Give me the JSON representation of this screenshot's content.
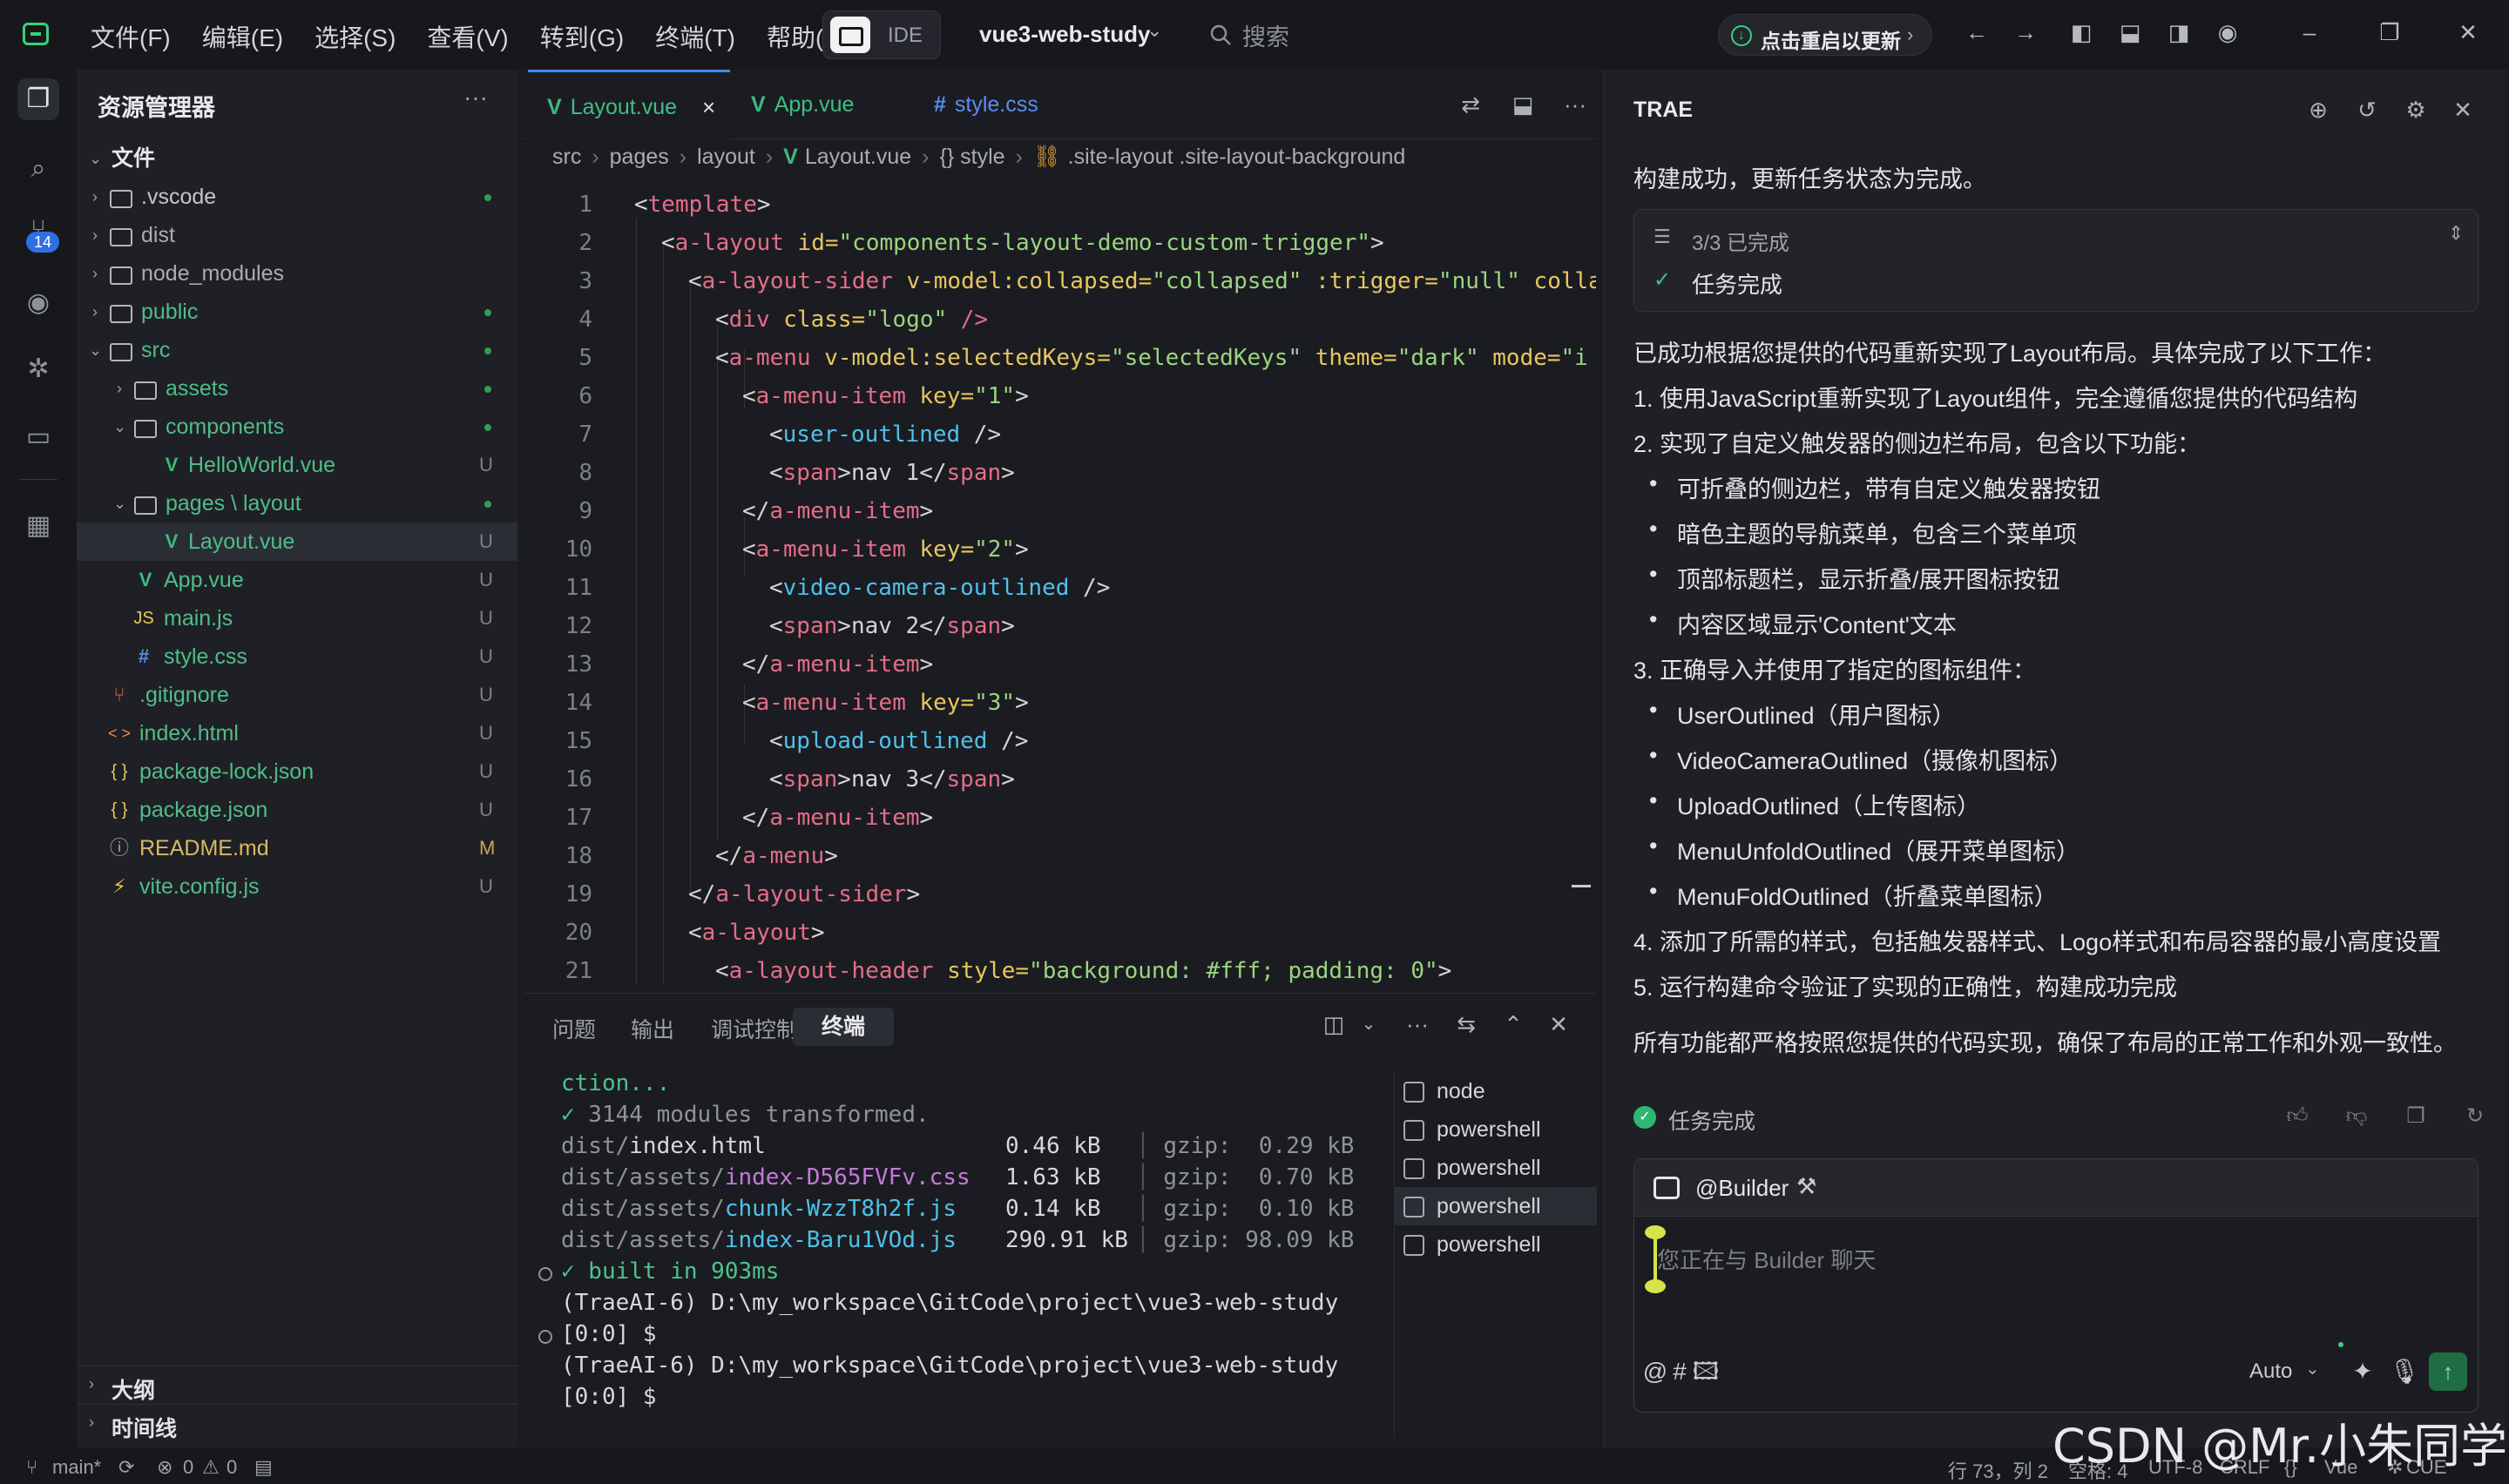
{
  "titlebar": {
    "menus": [
      "文件(F)",
      "编辑(E)",
      "选择(S)",
      "查看(V)",
      "转到(G)",
      "终端(T)",
      "帮助(H)"
    ],
    "mode_label": "IDE",
    "project": "vue3-web-study",
    "search_placeholder": "搜索",
    "update_label": "点击重启以更新"
  },
  "activity": {
    "badge": "14"
  },
  "explorer": {
    "title": "资源管理器",
    "root": "文件",
    "items": [
      {
        "name": ".vscode",
        "status": "",
        "dot": true
      },
      {
        "name": "dist",
        "status": "",
        "dot": false
      },
      {
        "name": "node_modules",
        "status": "",
        "dot": false
      },
      {
        "name": "public",
        "status": "",
        "dot": true
      },
      {
        "name": "src",
        "status": "",
        "dot": true
      },
      {
        "name": "assets",
        "status": "",
        "dot": true
      },
      {
        "name": "components",
        "status": "",
        "dot": true
      },
      {
        "name": "HelloWorld.vue",
        "status": "U"
      },
      {
        "name": "pages \\ layout",
        "status": "",
        "dot": true
      },
      {
        "name": "Layout.vue",
        "status": "U"
      },
      {
        "name": "App.vue",
        "status": "U"
      },
      {
        "name": "main.js",
        "status": "U"
      },
      {
        "name": "style.css",
        "status": "U"
      },
      {
        "name": ".gitignore",
        "status": "U"
      },
      {
        "name": "index.html",
        "status": "U"
      },
      {
        "name": "package-lock.json",
        "status": "U"
      },
      {
        "name": "package.json",
        "status": "U"
      },
      {
        "name": "README.md",
        "status": "M"
      },
      {
        "name": "vite.config.js",
        "status": "U"
      }
    ],
    "icons": {
      "js": "JS",
      "css": "#",
      "json": "{ }",
      "html": "< >",
      "info": "ⓘ",
      "git": "⑂",
      "vite": "⚡"
    },
    "outline_label": "大纲",
    "timeline_label": "时间线"
  },
  "editor": {
    "tabs": [
      "Layout.vue",
      "App.vue",
      "style.css"
    ],
    "breadcrumb": [
      "src",
      "pages",
      "layout",
      "Layout.vue",
      "{} style",
      ".site-layout .site-layout-background"
    ],
    "line_numbers": [
      "1",
      "2",
      "3",
      "4",
      "5",
      "6",
      "7",
      "8",
      "9",
      "10",
      "11",
      "12",
      "13",
      "14",
      "15",
      "16",
      "17",
      "18",
      "19",
      "20",
      "21"
    ],
    "code": {
      "l1_tag": "template",
      "l2_tag": "a-layout",
      "l2_attr": " id=",
      "l2_val": "\"components-layout-demo-custom-trigger\"",
      "l3_tag": "a-layout-sider",
      "l3_attr1": " v-model:collapsed=",
      "l3_val1": "\"collapsed\"",
      "l3_attr2": " :trigger=",
      "l3_val2": "\"null\"",
      "l3_rest": " colla",
      "l4_tag": "div",
      "l4_attr": " class=",
      "l4_val": "\"logo\"",
      "l4_end": " />",
      "l5_tag": "a-menu",
      "l5_attr1": " v-model:selectedKeys=",
      "l5_val1": "\"selectedKeys\"",
      "l5_attr2": " theme=",
      "l5_val2": "\"dark\"",
      "l5_attr3": " mode=",
      "l5_val3": "\"i",
      "item_tag": "a-menu-item",
      "key_attr": " key=",
      "key1": "\"1\"",
      "key2": "\"2\"",
      "key3": "\"3\"",
      "icon1": "user-outlined",
      "icon2": "video-camera-outlined",
      "icon3": "upload-outlined",
      "span_tag": "span",
      "nav1": "nav 1",
      "nav2": "nav 2",
      "nav3": "nav 3",
      "l18_tag": "a-menu",
      "l19_tag": "a-layout-sider",
      "l20_tag": "a-layout",
      "l21_tag": "a-layout-header",
      "l21_attr": " style=",
      "l21_val": "\"background: #fff; padding: 0\""
    }
  },
  "panel": {
    "tabs": [
      "问题",
      "输出",
      "调试控制台",
      "终端"
    ],
    "terminal": {
      "l1": "ction...",
      "l2_check": "✓",
      "l2": " 3144 modules transformed.",
      "files": [
        {
          "dir": "dist/",
          "file": "index.html",
          "size": "0.46 kB",
          "gzip": "gzip:  0.29 kB"
        },
        {
          "dir": "dist/assets/",
          "file": "index-D565FVFv.css",
          "size": "1.63 kB",
          "gzip": "gzip:  0.70 kB"
        },
        {
          "dir": "dist/assets/",
          "file": "chunk-WzzT8h2f.js",
          "size": "0.14 kB",
          "gzip": "gzip:  0.10 kB"
        },
        {
          "dir": "dist/assets/",
          "file": "index-Baru1VOd.js",
          "size": "290.91 kB",
          "gzip": "gzip: 98.09 kB"
        }
      ],
      "built": "✓ built in 903ms",
      "prompt1": "(TraeAI-6) D:\\my_workspace\\GitCode\\project\\vue3-web-study",
      "prompt1b": "[0:0] $",
      "prompt2": "(TraeAI-6) D:\\my_workspace\\GitCode\\project\\vue3-web-study",
      "prompt2b": "[0:0] $"
    },
    "terminal_list": [
      "node",
      "powershell",
      "powershell",
      "powershell",
      "powershell"
    ]
  },
  "chat": {
    "title": "TRAE",
    "intro": "构建成功，更新任务状态为完成。",
    "task_count": "3/3 已完成",
    "task_done": "任务完成",
    "summary": "已成功根据您提供的代码重新实现了Layout布局。具体完成了以下工作：",
    "p1": "1. 使用JavaScript重新实现了Layout组件，完全遵循您提供的代码结构",
    "p2": "2. 实现了自定义触发器的侧边栏布局，包含以下功能：",
    "p2_items": [
      "可折叠的侧边栏，带有自定义触发器按钮",
      "暗色主题的导航菜单，包含三个菜单项",
      "顶部标题栏，显示折叠/展开图标按钮",
      "内容区域显示'Content'文本"
    ],
    "p3": "3. 正确导入并使用了指定的图标组件：",
    "p3_items": [
      "UserOutlined（用户图标）",
      "VideoCameraOutlined（摄像机图标）",
      "UploadOutlined（上传图标）",
      "MenuUnfoldOutlined（展开菜单图标）",
      "MenuFoldOutlined（折叠菜单图标）"
    ],
    "p4": "4. 添加了所需的样式，包括触发器样式、Logo样式和布局容器的最小高度设置",
    "p5": "5. 运行构建命令验证了实现的正确性，构建成功完成",
    "closing": "所有功能都严格按照您提供的代码实现，确保了布局的正常工作和外观一致性。",
    "complete_label": "任务完成",
    "agent": "@Builder",
    "input_placeholder": "您正在与 Builder 聊天",
    "model": "Auto"
  },
  "statusbar": {
    "branch": "main*",
    "errors": "0",
    "warnings": "0",
    "position": "行 73，列 2",
    "spaces": "空格: 4",
    "encoding": "UTF-8",
    "eol": "CRLF",
    "braces": "{}",
    "language": "Vue",
    "cue": "CUE"
  },
  "watermark": "CSDN @Mr.小朱同学"
}
